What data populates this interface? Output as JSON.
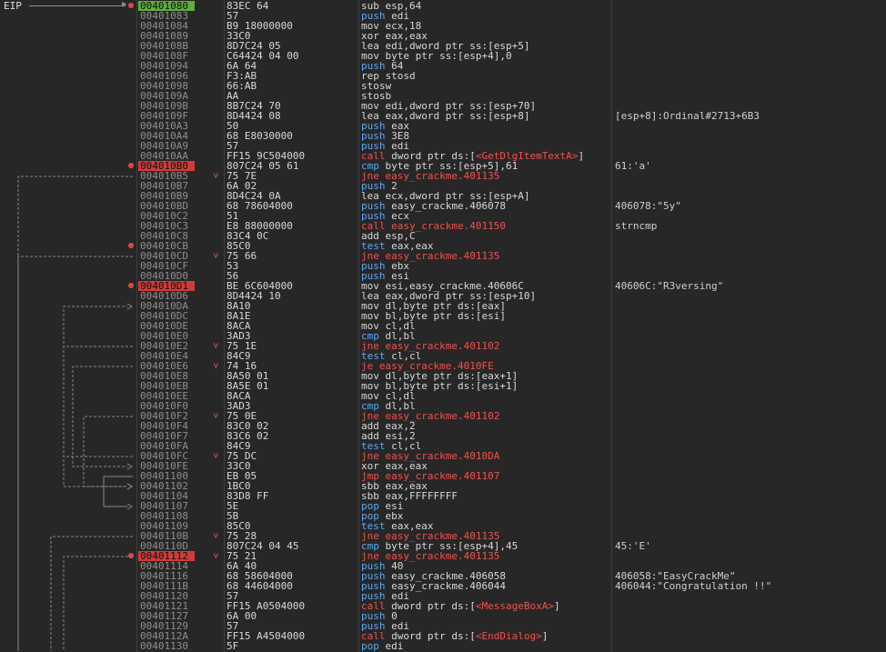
{
  "eip_label": "EIP",
  "colors": {
    "background": "#272727",
    "eip_highlight": "#5fae3c",
    "breakpoint": "#d23b3b",
    "address_text": "#8e8e8e",
    "mnemonic_blue": "#5ea7f2",
    "jump_red": "#f0514f",
    "gridline": "#3e3e3e"
  },
  "rows": [
    {
      "addr": "00401080",
      "bytes": "83EC 64",
      "mn": "sub",
      "ops": "esp,64",
      "cmt": "",
      "eip": true
    },
    {
      "addr": "00401083",
      "bytes": "57",
      "mn": "push",
      "ops": "edi",
      "cmt": ""
    },
    {
      "addr": "00401084",
      "bytes": "B9 18000000",
      "mn": "mov",
      "ops": "ecx,18",
      "cmt": ""
    },
    {
      "addr": "00401089",
      "bytes": "33C0",
      "mn": "xor",
      "ops": "eax,eax",
      "cmt": ""
    },
    {
      "addr": "0040108B",
      "bytes": "8D7C24 05",
      "mn": "lea",
      "ops": "edi,dword ptr ss:[esp+5]",
      "cmt": ""
    },
    {
      "addr": "0040108F",
      "bytes": "C64424 04 00",
      "mn": "mov",
      "ops": "byte ptr ss:[esp+4],0",
      "cmt": ""
    },
    {
      "addr": "00401094",
      "bytes": "6A 64",
      "mn": "push",
      "ops": "64",
      "cmt": ""
    },
    {
      "addr": "00401096",
      "bytes": "F3:AB",
      "mn": "rep stosd",
      "ops": "",
      "cmt": ""
    },
    {
      "addr": "00401098",
      "bytes": "66:AB",
      "mn": "stosw",
      "ops": "",
      "cmt": ""
    },
    {
      "addr": "0040109A",
      "bytes": "AA",
      "mn": "stosb",
      "ops": "",
      "cmt": ""
    },
    {
      "addr": "0040109B",
      "bytes": "8B7C24 70",
      "mn": "mov",
      "ops": "edi,dword ptr ss:[esp+70]",
      "cmt": ""
    },
    {
      "addr": "0040109F",
      "bytes": "8D4424 08",
      "mn": "lea",
      "ops": "eax,dword ptr ss:[esp+8]",
      "cmt": "[esp+8]:Ordinal#2713+6B3"
    },
    {
      "addr": "004010A3",
      "bytes": "50",
      "mn": "push",
      "ops": "eax",
      "cmt": ""
    },
    {
      "addr": "004010A4",
      "bytes": "68 E8030000",
      "mn": "push",
      "ops": "3E8",
      "cmt": ""
    },
    {
      "addr": "004010A9",
      "bytes": "57",
      "mn": "push",
      "ops": "edi",
      "cmt": ""
    },
    {
      "addr": "004010AA",
      "bytes": "FF15 9C504000",
      "mn": "call",
      "ops": "dword ptr ds:[<GetDlgItemTextA>]",
      "cmt": ""
    },
    {
      "addr": "004010B0",
      "bytes": "807C24 05 61",
      "mn": "cmp",
      "ops": "byte ptr ss:[esp+5],61",
      "cmt": "61:'a'",
      "bp": true
    },
    {
      "addr": "004010B5",
      "bytes": "75 7E",
      "mn": "jne",
      "ops": "easy_crackme.401135",
      "cmt": "",
      "tick": true
    },
    {
      "addr": "004010B7",
      "bytes": "6A 02",
      "mn": "push",
      "ops": "2",
      "cmt": ""
    },
    {
      "addr": "004010B9",
      "bytes": "8D4C24 0A",
      "mn": "lea",
      "ops": "ecx,dword ptr ss:[esp+A]",
      "cmt": ""
    },
    {
      "addr": "004010BD",
      "bytes": "68 78604000",
      "mn": "push",
      "ops": "easy_crackme.406078",
      "cmt": "406078:\"5y\""
    },
    {
      "addr": "004010C2",
      "bytes": "51",
      "mn": "push",
      "ops": "ecx",
      "cmt": ""
    },
    {
      "addr": "004010C3",
      "bytes": "E8 88000000",
      "mn": "call",
      "ops": "easy_crackme.401150",
      "cmt": "strncmp"
    },
    {
      "addr": "004010C8",
      "bytes": "83C4 0C",
      "mn": "add",
      "ops": "esp,C",
      "cmt": ""
    },
    {
      "addr": "004010CB",
      "bytes": "85C0",
      "mn": "test",
      "ops": "eax,eax",
      "cmt": "",
      "dot": true
    },
    {
      "addr": "004010CD",
      "bytes": "75 66",
      "mn": "jne",
      "ops": "easy_crackme.401135",
      "cmt": "",
      "tick": true
    },
    {
      "addr": "004010CF",
      "bytes": "53",
      "mn": "push",
      "ops": "ebx",
      "cmt": ""
    },
    {
      "addr": "004010D0",
      "bytes": "56",
      "mn": "push",
      "ops": "esi",
      "cmt": ""
    },
    {
      "addr": "004010D1",
      "bytes": "BE 6C604000",
      "mn": "mov",
      "ops": "esi,easy_crackme.40606C",
      "cmt": "40606C:\"R3versing\"",
      "bp": true
    },
    {
      "addr": "004010D6",
      "bytes": "8D4424 10",
      "mn": "lea",
      "ops": "eax,dword ptr ss:[esp+10]",
      "cmt": ""
    },
    {
      "addr": "004010DA",
      "bytes": "8A10",
      "mn": "mov",
      "ops": "dl,byte ptr ds:[eax]",
      "cmt": ""
    },
    {
      "addr": "004010DC",
      "bytes": "8A1E",
      "mn": "mov",
      "ops": "bl,byte ptr ds:[esi]",
      "cmt": ""
    },
    {
      "addr": "004010DE",
      "bytes": "8ACA",
      "mn": "mov",
      "ops": "cl,dl",
      "cmt": ""
    },
    {
      "addr": "004010E0",
      "bytes": "3AD3",
      "mn": "cmp",
      "ops": "dl,bl",
      "cmt": ""
    },
    {
      "addr": "004010E2",
      "bytes": "75 1E",
      "mn": "jne",
      "ops": "easy_crackme.401102",
      "cmt": "",
      "tick": true
    },
    {
      "addr": "004010E4",
      "bytes": "84C9",
      "mn": "test",
      "ops": "cl,cl",
      "cmt": ""
    },
    {
      "addr": "004010E6",
      "bytes": "74 16",
      "mn": "je",
      "ops": "easy_crackme.4010FE",
      "cmt": "",
      "tick": true
    },
    {
      "addr": "004010E8",
      "bytes": "8A50 01",
      "mn": "mov",
      "ops": "dl,byte ptr ds:[eax+1]",
      "cmt": ""
    },
    {
      "addr": "004010EB",
      "bytes": "8A5E 01",
      "mn": "mov",
      "ops": "bl,byte ptr ds:[esi+1]",
      "cmt": ""
    },
    {
      "addr": "004010EE",
      "bytes": "8ACA",
      "mn": "mov",
      "ops": "cl,dl",
      "cmt": ""
    },
    {
      "addr": "004010F0",
      "bytes": "3AD3",
      "mn": "cmp",
      "ops": "dl,bl",
      "cmt": ""
    },
    {
      "addr": "004010F2",
      "bytes": "75 0E",
      "mn": "jne",
      "ops": "easy_crackme.401102",
      "cmt": "",
      "tick": true
    },
    {
      "addr": "004010F4",
      "bytes": "83C0 02",
      "mn": "add",
      "ops": "eax,2",
      "cmt": ""
    },
    {
      "addr": "004010F7",
      "bytes": "83C6 02",
      "mn": "add",
      "ops": "esi,2",
      "cmt": ""
    },
    {
      "addr": "004010FA",
      "bytes": "84C9",
      "mn": "test",
      "ops": "cl,cl",
      "cmt": ""
    },
    {
      "addr": "004010FC",
      "bytes": "75 DC",
      "mn": "jne",
      "ops": "easy_crackme.4010DA",
      "cmt": "",
      "tick": true
    },
    {
      "addr": "004010FE",
      "bytes": "33C0",
      "mn": "xor",
      "ops": "eax,eax",
      "cmt": ""
    },
    {
      "addr": "00401100",
      "bytes": "EB 05",
      "mn": "jmp",
      "ops": "easy_crackme.401107",
      "cmt": ""
    },
    {
      "addr": "00401102",
      "bytes": "1BC0",
      "mn": "sbb",
      "ops": "eax,eax",
      "cmt": ""
    },
    {
      "addr": "00401104",
      "bytes": "83D8 FF",
      "mn": "sbb",
      "ops": "eax,FFFFFFFF",
      "cmt": ""
    },
    {
      "addr": "00401107",
      "bytes": "5E",
      "mn": "pop",
      "ops": "esi",
      "cmt": ""
    },
    {
      "addr": "00401108",
      "bytes": "5B",
      "mn": "pop",
      "ops": "ebx",
      "cmt": ""
    },
    {
      "addr": "00401109",
      "bytes": "85C0",
      "mn": "test",
      "ops": "eax,eax",
      "cmt": ""
    },
    {
      "addr": "0040110B",
      "bytes": "75 28",
      "mn": "jne",
      "ops": "easy_crackme.401135",
      "cmt": "",
      "tick": true
    },
    {
      "addr": "0040110D",
      "bytes": "807C24 04 45",
      "mn": "cmp",
      "ops": "byte ptr ss:[esp+4],45",
      "cmt": "45:'E'"
    },
    {
      "addr": "00401112",
      "bytes": "75 21",
      "mn": "jne",
      "ops": "easy_crackme.401135",
      "cmt": "",
      "bp": true,
      "tick": true
    },
    {
      "addr": "00401114",
      "bytes": "6A 40",
      "mn": "push",
      "ops": "40",
      "cmt": ""
    },
    {
      "addr": "00401116",
      "bytes": "68 58604000",
      "mn": "push",
      "ops": "easy_crackme.406058",
      "cmt": "406058:\"EasyCrackMe\""
    },
    {
      "addr": "0040111B",
      "bytes": "68 44604000",
      "mn": "push",
      "ops": "easy_crackme.406044",
      "cmt": "406044:\"Congratulation !!\""
    },
    {
      "addr": "00401120",
      "bytes": "57",
      "mn": "push",
      "ops": "edi",
      "cmt": ""
    },
    {
      "addr": "00401121",
      "bytes": "FF15 A0504000",
      "mn": "call",
      "ops": "dword ptr ds:[<MessageBoxA>]",
      "cmt": ""
    },
    {
      "addr": "00401127",
      "bytes": "6A 00",
      "mn": "push",
      "ops": "0",
      "cmt": ""
    },
    {
      "addr": "00401129",
      "bytes": "57",
      "mn": "push",
      "ops": "edi",
      "cmt": ""
    },
    {
      "addr": "0040112A",
      "bytes": "FF15 A4504000",
      "mn": "call",
      "ops": "dword ptr ds:[<EndDialog>]",
      "cmt": ""
    },
    {
      "addr": "00401130",
      "bytes": "5F",
      "mn": "pop",
      "ops": "edi",
      "cmt": ""
    }
  ]
}
